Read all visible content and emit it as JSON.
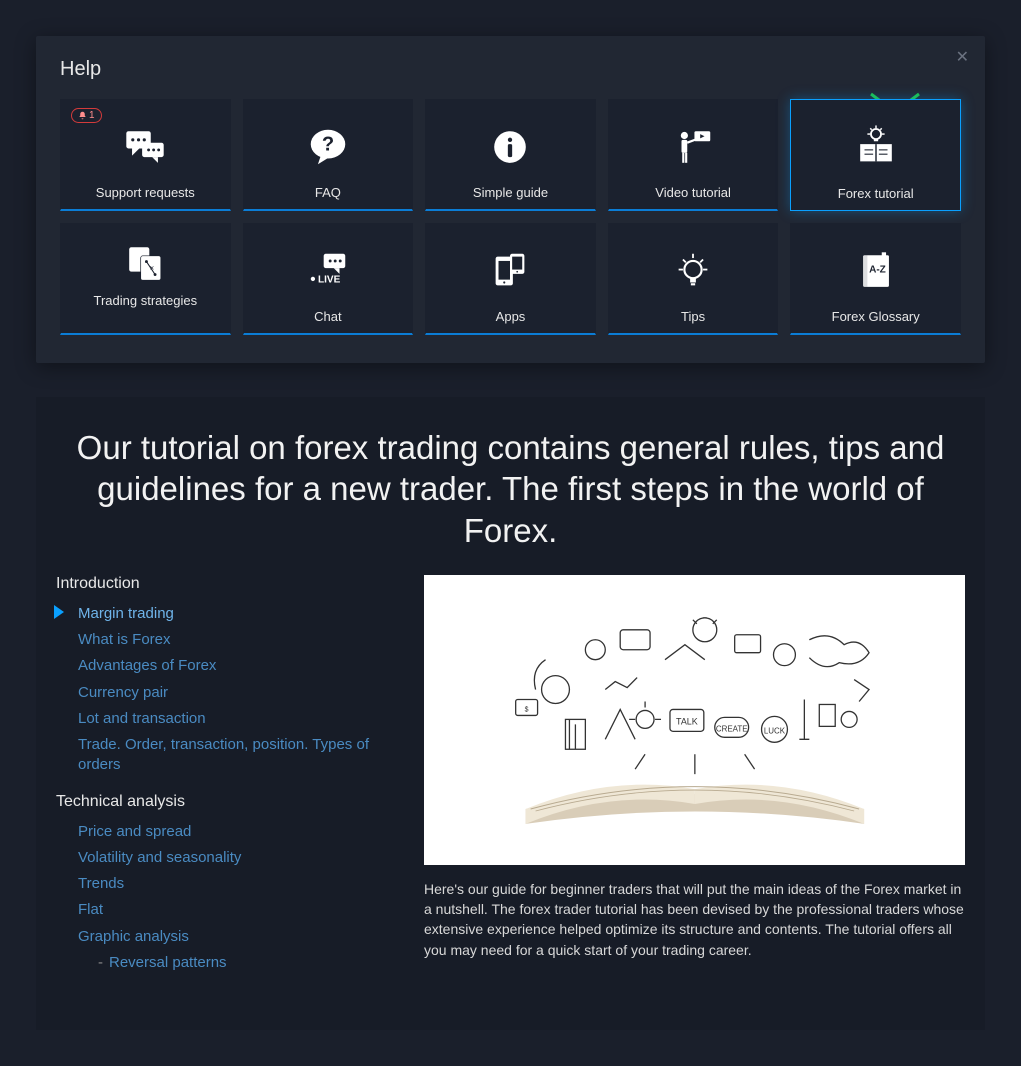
{
  "help": {
    "title": "Help",
    "badge_count": "1",
    "cards": [
      {
        "label": "Support requests"
      },
      {
        "label": "FAQ"
      },
      {
        "label": "Simple guide"
      },
      {
        "label": "Video tutorial"
      },
      {
        "label": "Forex tutorial"
      },
      {
        "label": "Trading strategies"
      },
      {
        "label": "Chat"
      },
      {
        "label": "Apps"
      },
      {
        "label": "Tips"
      },
      {
        "label": "Forex Glossary"
      }
    ]
  },
  "hero": {
    "headline": "Our tutorial on forex trading contains general rules, tips and guidelines for a new trader. The first steps in the world of Forex."
  },
  "nav": {
    "sections": [
      {
        "title": "Introduction",
        "items": [
          {
            "label": "Margin trading",
            "active": true
          },
          {
            "label": "What is Forex"
          },
          {
            "label": "Advantages of Forex"
          },
          {
            "label": "Currency pair"
          },
          {
            "label": "Lot and transaction"
          },
          {
            "label": "Trade. Order, transaction, position. Types of orders"
          }
        ]
      },
      {
        "title": "Technical analysis",
        "items": [
          {
            "label": "Price and spread"
          },
          {
            "label": "Volatility and seasonality"
          },
          {
            "label": "Trends"
          },
          {
            "label": "Flat"
          },
          {
            "label": "Graphic analysis",
            "children": [
              {
                "label": "Reversal patterns"
              }
            ]
          }
        ]
      }
    ]
  },
  "article": {
    "intro": "Here's our guide for beginner traders that will put the main ideas of the Forex market in a nutshell. The forex trader tutorial has been devised by the professional traders whose extensive experience helped optimize its structure and contents. The tutorial offers all you may need for a quick start of your trading career."
  }
}
